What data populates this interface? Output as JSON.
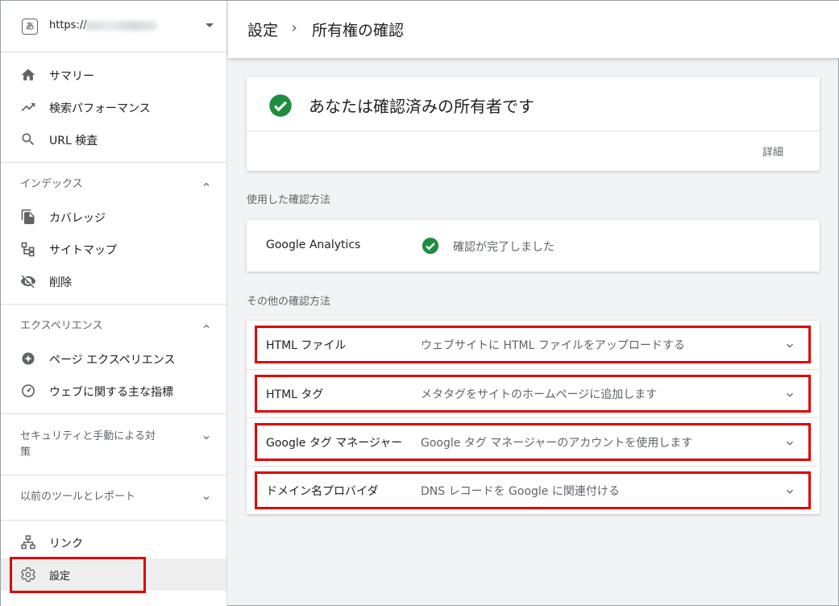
{
  "property": {
    "url_prefix": "https://",
    "favicon_glyph": "あ"
  },
  "sidebar": {
    "top_items": [
      {
        "label": "サマリー",
        "icon": "home-icon"
      },
      {
        "label": "検索パフォーマンス",
        "icon": "trending-up-icon"
      },
      {
        "label": "URL 検査",
        "icon": "search-icon"
      }
    ],
    "index_section": {
      "title": "インデックス",
      "items": [
        {
          "label": "カバレッジ",
          "icon": "file-copy-icon"
        },
        {
          "label": "サイトマップ",
          "icon": "sitemap-icon"
        },
        {
          "label": "削除",
          "icon": "visibility-off-icon"
        }
      ]
    },
    "experience_section": {
      "title": "エクスペリエンス",
      "items": [
        {
          "label": "ページ エクスペリエンス",
          "icon": "page-experience-icon"
        },
        {
          "label": "ウェブに関する主な指標",
          "icon": "speed-gauge-icon"
        }
      ]
    },
    "security_section": {
      "title_line1": "セキュリティと手動による対",
      "title_line2": "策"
    },
    "legacy_section": {
      "title": "以前のツールとレポート"
    },
    "bottom_items": [
      {
        "label": "リンク",
        "icon": "link-network-icon"
      },
      {
        "label": "設定",
        "icon": "gear-icon"
      }
    ]
  },
  "header": {
    "crumb_root": "設定",
    "crumb_current": "所有権の確認"
  },
  "owner_card": {
    "title": "あなたは確認済みの所有者です",
    "details_label": "詳細"
  },
  "used_methods": {
    "heading": "使用した確認方法",
    "method_name": "Google Analytics",
    "status": "確認が完了しました"
  },
  "other_methods": {
    "heading": "その他の確認方法",
    "items": [
      {
        "name": "HTML ファイル",
        "desc": "ウェブサイトに HTML ファイルをアップロードする"
      },
      {
        "name": "HTML タグ",
        "desc": "メタタグをサイトのホームページに追加します"
      },
      {
        "name": "Google タグ マネージャー",
        "desc": "Google タグ マネージャーのアカウントを使用します"
      },
      {
        "name": "ドメイン名プロバイダ",
        "desc": "DNS レコードを Google に関連付ける"
      }
    ]
  },
  "colors": {
    "success_green": "#1e8e3e",
    "highlight_red": "#e00000",
    "icon_gray": "#5f6368"
  }
}
